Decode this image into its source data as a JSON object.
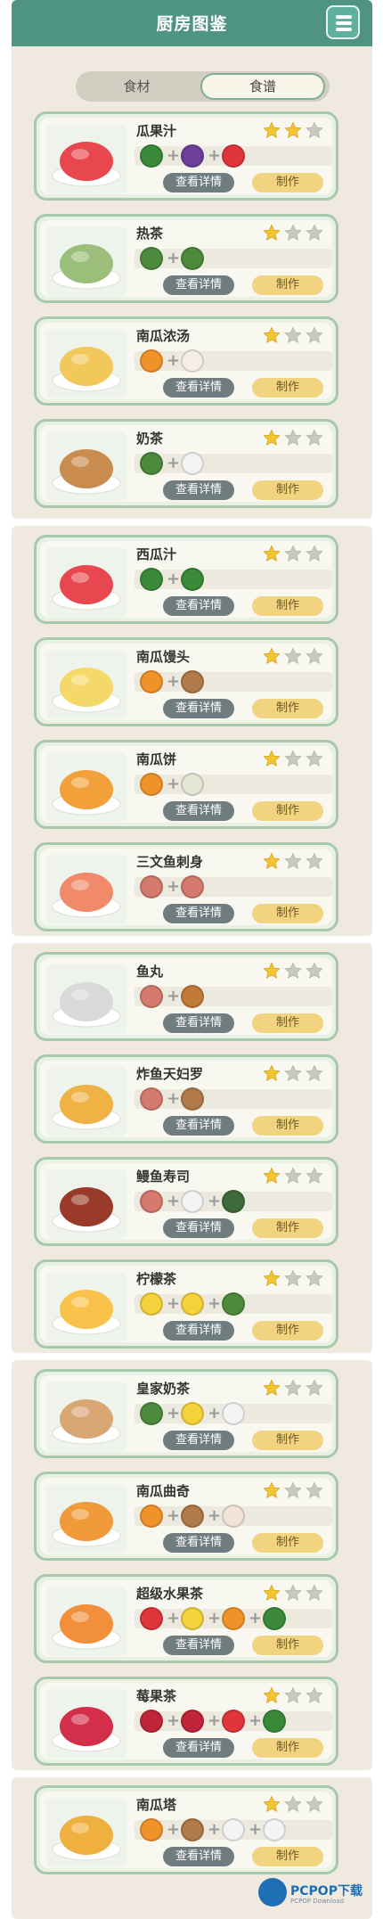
{
  "header": {
    "title": "厨房图鉴"
  },
  "tabs": [
    {
      "label": "食材"
    },
    {
      "label": "食谱"
    }
  ],
  "buttons": {
    "detail": "查看详情",
    "make": "制作"
  },
  "recipes": [
    {
      "name": "瓜果汁",
      "stars": 2
    },
    {
      "name": "热茶",
      "stars": 1
    },
    {
      "name": "南瓜浓汤",
      "stars": 1
    },
    {
      "name": "奶茶",
      "stars": 1
    },
    {
      "name": "西瓜汁",
      "stars": 1
    },
    {
      "name": "南瓜馒头",
      "stars": 1
    },
    {
      "name": "南瓜饼",
      "stars": 1
    },
    {
      "name": "三文鱼刺身",
      "stars": 1
    },
    {
      "name": "鱼丸",
      "stars": 1
    },
    {
      "name": "炸鱼天妇罗",
      "stars": 1
    },
    {
      "name": "鳗鱼寿司",
      "stars": 1
    },
    {
      "name": "柠檬茶",
      "stars": 1
    },
    {
      "name": "皇家奶茶",
      "stars": 1
    },
    {
      "name": "南瓜曲奇",
      "stars": 1
    },
    {
      "name": "超级水果茶",
      "stars": 1
    },
    {
      "name": "莓果茶",
      "stars": 1
    },
    {
      "name": "南瓜塔",
      "stars": 1
    }
  ],
  "watermark": {
    "brand": "PCPOP下载",
    "sub": "PCPOP Download"
  }
}
